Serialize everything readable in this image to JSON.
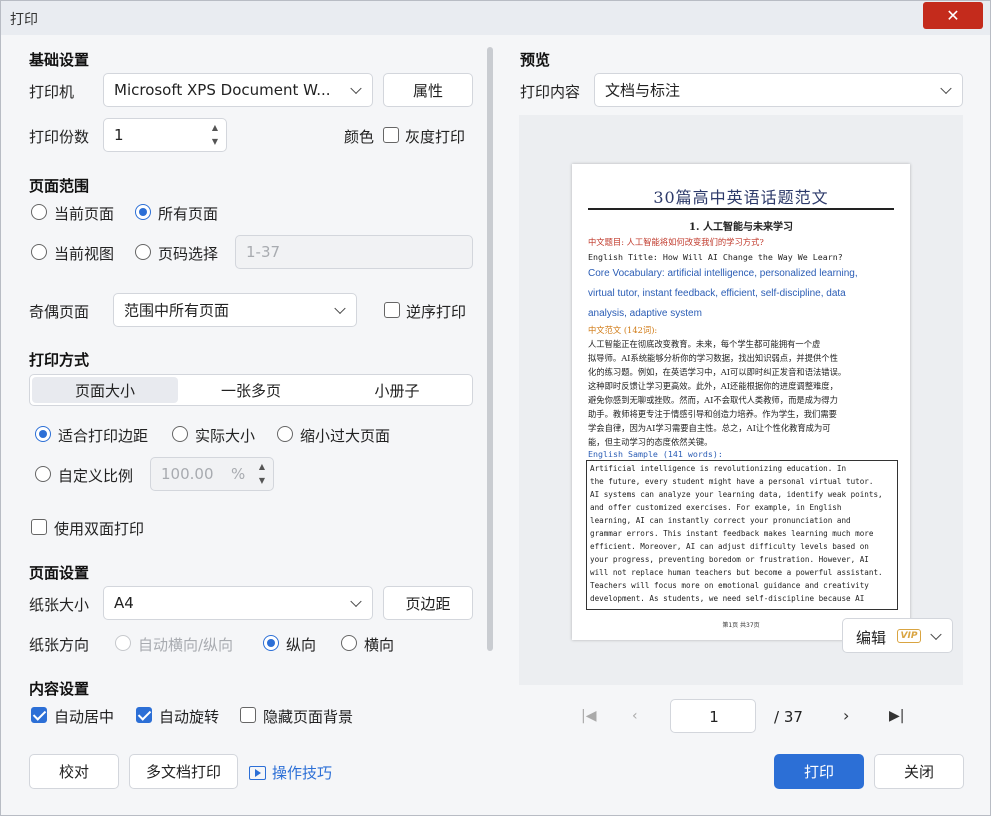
{
  "window": {
    "title": "打印",
    "close_glyph": "✕"
  },
  "basic": {
    "section": "基础设置",
    "printer_label": "打印机",
    "printer_value": "Microsoft XPS Document W...",
    "properties_button": "属性",
    "copies_label": "打印份数",
    "copies_value": "1",
    "color_label": "颜色",
    "grayscale_label": "灰度打印"
  },
  "range": {
    "section": "页面范围",
    "current_page": "当前页面",
    "all_pages": "所有页面",
    "current_view": "当前视图",
    "page_select": "页码选择",
    "page_select_placeholder": "1-37",
    "odd_even_label": "奇偶页面",
    "odd_even_value": "范围中所有页面",
    "reverse_label": "逆序打印"
  },
  "mode": {
    "section": "打印方式",
    "tabs": [
      "页面大小",
      "一张多页",
      "小册子"
    ],
    "fit_margins": "适合打印边距",
    "actual_size": "实际大小",
    "shrink_large": "缩小过大页面",
    "custom_scale": "自定义比例",
    "custom_scale_value": "100.00",
    "custom_scale_unit": "%",
    "duplex": "使用双面打印"
  },
  "page_setup": {
    "section": "页面设置",
    "paper_label": "纸张大小",
    "paper_value": "A4",
    "margins_button": "页边距",
    "orientation_label": "纸张方向",
    "auto_orient": "自动横向/纵向",
    "portrait": "纵向",
    "landscape": "横向"
  },
  "content": {
    "section": "内容设置",
    "auto_center": "自动居中",
    "auto_rotate": "自动旋转",
    "hide_bg": "隐藏页面背景"
  },
  "preview": {
    "section": "预览",
    "content_label": "打印内容",
    "content_value": "文档与标注",
    "doc_title": "30篇高中英语话题范文",
    "doc_heading": "1.  人工智能与未来学习",
    "lines": {
      "cn_topic": "中文题目: 人工智能将如何改变我们的学习方式?",
      "en_title": "English Title: How Will AI Change the Way We Learn?",
      "vocab1": "Core Vocabulary: artificial intelligence, personalized learning,",
      "vocab2": "virtual tutor, instant feedback, efficient, self-discipline, data",
      "vocab3": "analysis, adaptive system",
      "cn_essay": "中文范文 (142词):",
      "cn1": "    人工智能正在彻底改变教育。未来，每个学生都可能拥有一个虚",
      "cn2": "拟导师。AI系统能够分析你的学习数据，找出知识弱点，并提供个性",
      "cn3": "化的练习题。例如，在英语学习中，AI可以即时纠正发音和语法错误。",
      "cn4": "这种即时反馈让学习更高效。此外，AI还能根据你的进度调整难度，",
      "cn5": "避免你感到无聊或挫败。然而，AI不会取代人类教师，而是成为得力",
      "cn6": "助手。教师将更专注于情感引导和创造力培养。作为学生，我们需要",
      "cn7": "学会自律，因为AI学习需要自主性。总之，AI让个性化教育成为可",
      "cn8": "能，但主动学习的态度依然关键。",
      "en_sample": "English Sample (141 words):",
      "en1": "    Artificial intelligence is revolutionizing education. In",
      "en2": "the future, every student might have a personal virtual tutor.",
      "en3": "AI systems can analyze your learning data, identify weak points,",
      "en4": "and offer customized exercises. For example, in English",
      "en5": "learning, AI can instantly correct your pronunciation and",
      "en6": "grammar errors. This instant feedback makes learning much more",
      "en7": "efficient. Moreover, AI can adjust difficulty levels based on",
      "en8": "your progress, preventing boredom or frustration. However, AI",
      "en9": "will not replace human teachers but become a powerful assistant.",
      "en10": "Teachers will focus more on emotional guidance and creativity",
      "en11": "development. As students, we need self-discipline because AI"
    },
    "page_footer": "第1页 共37页",
    "edit_button": "编辑",
    "vip_badge": "VIP",
    "current_page": "1",
    "total_pages": "/ 37"
  },
  "footer": {
    "proofread": "校对",
    "multi_doc": "多文档打印",
    "tips": "操作技巧",
    "print": "打印",
    "close": "关闭"
  },
  "colors": {
    "accent": "#2c6fd6",
    "close_red": "#c42b1c"
  }
}
